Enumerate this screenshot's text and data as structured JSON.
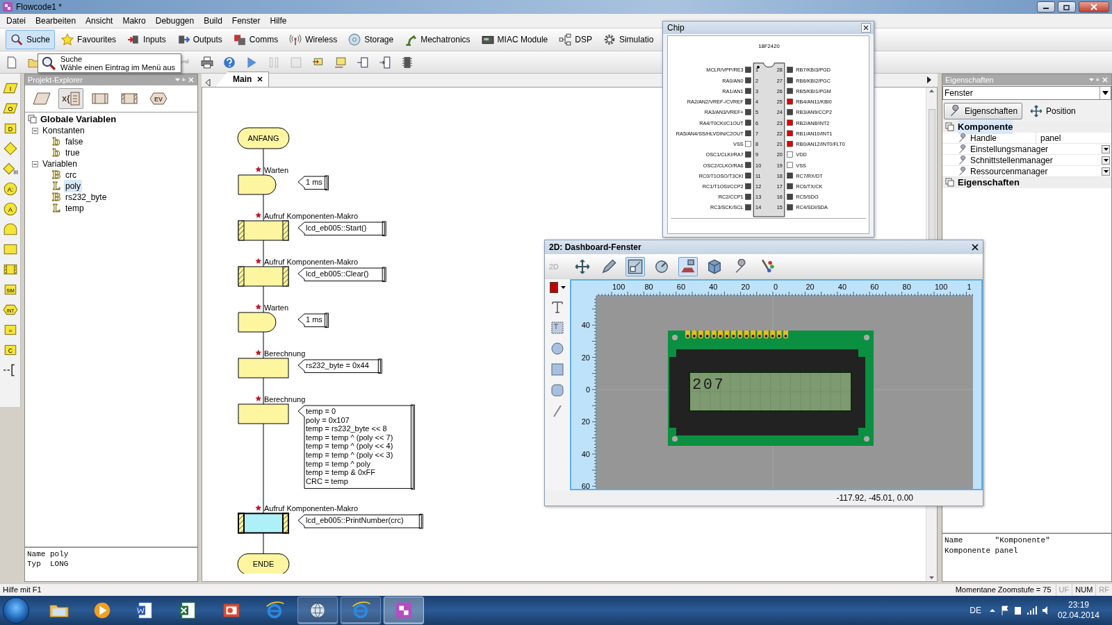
{
  "window": {
    "title": "Flowcode1 *"
  },
  "menu": [
    "Datei",
    "Bearbeiten",
    "Ansicht",
    "Makro",
    "Debuggen",
    "Build",
    "Fenster",
    "Hilfe"
  ],
  "component_toolbar": [
    {
      "label": "Suche",
      "kind": "search",
      "selected": true
    },
    {
      "label": "Favourites",
      "kind": "star",
      "selected": false
    },
    {
      "label": "Inputs",
      "kind": "input",
      "selected": false
    },
    {
      "label": "Outputs",
      "kind": "output",
      "selected": false
    },
    {
      "label": "Comms",
      "kind": "comms",
      "selected": false
    },
    {
      "label": "Wireless",
      "kind": "wireless",
      "selected": false
    },
    {
      "label": "Storage",
      "kind": "disc",
      "selected": false
    },
    {
      "label": "Mechatronics",
      "kind": "arm",
      "selected": false
    },
    {
      "label": "MIAC Module",
      "kind": "module",
      "selected": false
    },
    {
      "label": "DSP",
      "kind": "dsp",
      "selected": false
    },
    {
      "label": "Simulatio",
      "kind": "gear",
      "selected": false
    }
  ],
  "main_toolbar": [
    {
      "kind": "newdoc",
      "disabled": false
    },
    {
      "kind": "folder",
      "disabled": false
    },
    {
      "kind": "redo",
      "disabled": true
    },
    {
      "kind": "print",
      "disabled": false
    },
    {
      "kind": "help",
      "disabled": false
    },
    {
      "kind": "play",
      "disabled": false
    },
    {
      "kind": "pause",
      "disabled": true
    },
    {
      "kind": "stop",
      "disabled": true
    },
    {
      "kind": "stepin",
      "disabled": false
    },
    {
      "kind": "stepover",
      "disabled": false
    },
    {
      "kind": "compin",
      "disabled": false
    },
    {
      "kind": "compbin",
      "disabled": false
    },
    {
      "kind": "chip",
      "disabled": false
    }
  ],
  "tooltip": {
    "title": "Suche",
    "text": "Wähle einen Eintrag im Menü aus"
  },
  "palette": [
    {
      "kind": "io",
      "glyph": "I"
    },
    {
      "kind": "io",
      "glyph": "O"
    },
    {
      "kind": "box",
      "glyph": "D"
    },
    {
      "kind": "decision"
    },
    {
      "kind": "switch"
    },
    {
      "kind": "circle",
      "glyph": "A:"
    },
    {
      "kind": "circle",
      "glyph": "A"
    },
    {
      "kind": "wait"
    },
    {
      "kind": "rect"
    },
    {
      "kind": "macro"
    },
    {
      "kind": "box",
      "glyph": "SIM"
    },
    {
      "kind": "hex",
      "glyph": "INT"
    },
    {
      "kind": "box",
      "glyph": "="
    },
    {
      "kind": "box",
      "glyph": "C"
    },
    {
      "kind": "comment"
    }
  ],
  "project_explorer": {
    "title": "Projekt-Explorer",
    "tabs": [
      {
        "kind": "parallelogram",
        "selected": false
      },
      {
        "kind": "variables",
        "glyph": "x{",
        "selected": true
      },
      {
        "kind": "macro",
        "selected": false
      },
      {
        "kind": "component",
        "selected": false
      },
      {
        "kind": "hex",
        "glyph": "EV",
        "selected": false
      }
    ],
    "tree": {
      "label": "Globale Variablen",
      "children": [
        {
          "label": "Konstanten",
          "expanded": true,
          "children": [
            {
              "label": "false",
              "type_glyph": "b",
              "selected": false
            },
            {
              "label": "true",
              "type_glyph": "b",
              "selected": false
            }
          ]
        },
        {
          "label": "Variablen",
          "expanded": true,
          "children": [
            {
              "label": "crc",
              "type_glyph": "B",
              "selected": false
            },
            {
              "label": "poly",
              "type_glyph": "L",
              "selected": true
            },
            {
              "label": "rs232_byte",
              "type_glyph": "B",
              "selected": false
            },
            {
              "label": "temp",
              "type_glyph": "L",
              "selected": false
            }
          ]
        }
      ]
    },
    "info": [
      "Name poly",
      "Typ  LONG"
    ]
  },
  "editor": {
    "tabs": [
      {
        "label": "Main",
        "selected": true
      }
    ],
    "flowchart": [
      {
        "kind": "start",
        "label": "ANFANG",
        "selected": false
      },
      {
        "kind": "wait",
        "title": "Warten",
        "annotation": [
          "1 ms"
        ],
        "selected": false
      },
      {
        "kind": "macro",
        "title": "Aufruf Komponenten-Makro",
        "annotation": [
          "lcd_eb005::Start()"
        ],
        "selected": false
      },
      {
        "kind": "macro",
        "title": "Aufruf Komponenten-Makro",
        "annotation": [
          "lcd_eb005::Clear()"
        ],
        "selected": false
      },
      {
        "kind": "wait",
        "title": "Warten",
        "annotation": [
          "1 ms"
        ],
        "selected": false
      },
      {
        "kind": "calc",
        "title": "Berechnung",
        "annotation": [
          "rs232_byte = 0x44"
        ],
        "selected": false
      },
      {
        "kind": "calc",
        "title": "Berechnung",
        "annotation": [
          "temp = 0",
          "poly = 0x107",
          "temp = rs232_byte << 8",
          "temp = temp ^ (poly << 7)",
          "temp = temp ^ (poly << 4)",
          "temp = temp ^ (poly << 3)",
          "temp = temp ^ poly",
          "temp = temp & 0xFF",
          "CRC = temp"
        ],
        "selected": false
      },
      {
        "kind": "macro",
        "title": "Aufruf Komponenten-Makro",
        "annotation": [
          "lcd_eb005::PrintNumber(crc)"
        ],
        "selected": true
      },
      {
        "kind": "end",
        "label": "ENDE",
        "selected": false
      }
    ]
  },
  "chip_window": {
    "title": "Chip",
    "part": "18F2420",
    "left_pins": [
      {
        "number": "1",
        "name": "MCLR/VPP/RE3",
        "kind": "io",
        "on": false
      },
      {
        "number": "2",
        "name": "RA0/AN0",
        "kind": "io",
        "on": false
      },
      {
        "number": "3",
        "name": "RA1/AN1",
        "kind": "io",
        "on": false
      },
      {
        "number": "4",
        "name": "RA2/AN2/VREF-/CVREF",
        "kind": "io",
        "on": false
      },
      {
        "number": "5",
        "name": "RA3/AN3/VREF+",
        "kind": "io",
        "on": false
      },
      {
        "number": "6",
        "name": "RA4/T0CKI/C1OUT",
        "kind": "io",
        "on": false
      },
      {
        "number": "7",
        "name": "RA5/AN4/SS/HLVDIN/C2OUT",
        "kind": "io",
        "on": false
      },
      {
        "number": "8",
        "name": "VSS",
        "kind": "power",
        "on": false
      },
      {
        "number": "9",
        "name": "OSC1/CLKI/RA7",
        "kind": "io",
        "on": false
      },
      {
        "number": "10",
        "name": "OSC2/CLKO/RA6",
        "kind": "io",
        "on": false
      },
      {
        "number": "11",
        "name": "RC0/T1OSO/T3CKI",
        "kind": "io",
        "on": false
      },
      {
        "number": "12",
        "name": "RC1/T1OSI/CCP2",
        "kind": "io",
        "on": false
      },
      {
        "number": "13",
        "name": "RC2/CCP1",
        "kind": "io",
        "on": false
      },
      {
        "number": "14",
        "name": "RC3/SCK/SCL",
        "kind": "io",
        "on": false
      }
    ],
    "right_pins": [
      {
        "number": "28",
        "name": "RB7/KBI3/PGD",
        "kind": "io",
        "on": false
      },
      {
        "number": "27",
        "name": "RB6/KBI2/PGC",
        "kind": "io",
        "on": false
      },
      {
        "number": "26",
        "name": "RB5/KBI1/PGM",
        "kind": "io",
        "on": false
      },
      {
        "number": "25",
        "name": "RB4/AN11/KBI0",
        "kind": "io",
        "on": true
      },
      {
        "number": "24",
        "name": "RB3/AN9/CCP2",
        "kind": "io",
        "on": false
      },
      {
        "number": "23",
        "name": "RB2/AN8/INT2",
        "kind": "io",
        "on": true
      },
      {
        "number": "22",
        "name": "RB1/AN10/INT1",
        "kind": "io",
        "on": true
      },
      {
        "number": "21",
        "name": "RB0/AN12/INT0/FLT0",
        "kind": "io",
        "on": true
      },
      {
        "number": "20",
        "name": "VDD",
        "kind": "power",
        "on": false
      },
      {
        "number": "19",
        "name": "VSS",
        "kind": "power",
        "on": false
      },
      {
        "number": "18",
        "name": "RC7/RX/DT",
        "kind": "io",
        "on": false
      },
      {
        "number": "17",
        "name": "RC6/TX/CK",
        "kind": "io",
        "on": false
      },
      {
        "number": "16",
        "name": "RC5/SDO",
        "kind": "io",
        "on": false
      },
      {
        "number": "15",
        "name": "RC4/SDI/SDA",
        "kind": "io",
        "on": false
      }
    ]
  },
  "dashboard_window": {
    "title": "2D: Dashboard-Fenster",
    "mode_label": "2D",
    "tools": [
      {
        "kind": "move",
        "pressed": false
      },
      {
        "kind": "pen",
        "pressed": false
      },
      {
        "kind": "scale",
        "pressed": true
      },
      {
        "kind": "rotate",
        "pressed": false
      },
      {
        "kind": "layout",
        "pressed": true
      },
      {
        "kind": "cube",
        "pressed": false
      },
      {
        "kind": "wrench",
        "pressed": false
      },
      {
        "kind": "paint",
        "pressed": false
      }
    ],
    "side_tools": [
      {
        "kind": "text"
      },
      {
        "kind": "textbox"
      },
      {
        "kind": "circle"
      },
      {
        "kind": "square"
      },
      {
        "kind": "roundrect"
      },
      {
        "kind": "line"
      }
    ],
    "x_ticks": [
      "100",
      "80",
      "60",
      "40",
      "20",
      "0",
      "20",
      "40",
      "60",
      "80",
      "100",
      "1"
    ],
    "y_ticks": [
      "40",
      "20",
      "0",
      "20",
      "40",
      "60"
    ],
    "lcd": {
      "text": "207"
    },
    "coordinates": "-117.92, -45.01, 0.00"
  },
  "properties": {
    "title": "Eigenschaften",
    "selector": "Fenster",
    "tabs": [
      {
        "label": "Eigenschaften",
        "kind": "wrench",
        "selected": true
      },
      {
        "label": "Position",
        "kind": "move",
        "selected": false
      }
    ],
    "sections": [
      {
        "label": "Komponente",
        "selected": true,
        "rows": [
          {
            "name": "Handle",
            "value": "panel",
            "dropdown": false
          },
          {
            "name": "Einstellungsmanager",
            "dropdown": true
          },
          {
            "name": "Schnittstellenmanager",
            "dropdown": true
          },
          {
            "name": "Ressourcenmanager",
            "dropdown": true
          }
        ]
      },
      {
        "label": "Eigenschaften",
        "selected": false
      }
    ],
    "info": [
      "Name       \"Komponente\"",
      "Komponente panel"
    ]
  },
  "status_bar": {
    "help": "Hilfe mit F1",
    "zoom": "Momentane Zoomstufe = 75",
    "indicators": [
      {
        "label": "UF",
        "on": false
      },
      {
        "label": "NUM",
        "on": true
      },
      {
        "label": "RF",
        "on": false
      }
    ]
  },
  "taskbar": {
    "apps": [
      {
        "kind": "folder",
        "open": false,
        "selected": false
      },
      {
        "kind": "media",
        "open": false,
        "selected": false
      },
      {
        "kind": "word",
        "open": false,
        "selected": false
      },
      {
        "kind": "excel",
        "open": false,
        "selected": false
      },
      {
        "kind": "presentation",
        "open": false,
        "selected": false
      },
      {
        "kind": "browser",
        "open": false,
        "selected": false
      },
      {
        "kind": "chat",
        "open": true,
        "selected": false
      },
      {
        "kind": "browser",
        "open": true,
        "selected": false
      },
      {
        "kind": "flowcode",
        "open": true,
        "selected": true
      }
    ],
    "language": "DE",
    "time": "23:19",
    "date": "02.04.2014"
  }
}
